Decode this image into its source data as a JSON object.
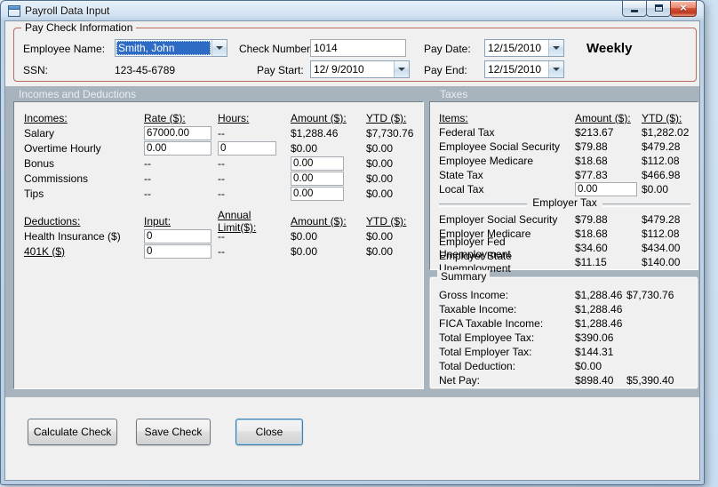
{
  "window": {
    "title": "Payroll Data Input",
    "icons": {
      "close": "×"
    }
  },
  "paycheck": {
    "legend": "Pay Check Information",
    "fields": {
      "employee_name": {
        "label": "Employee Name:",
        "value": "Smith, John"
      },
      "ssn": {
        "label": "SSN:",
        "value": "123-45-6789"
      },
      "check_number": {
        "label": "Check Number:",
        "value": "1014"
      },
      "pay_start": {
        "label": "Pay Start:",
        "value": "12/ 9/2010"
      },
      "pay_date": {
        "label": "Pay Date:",
        "value": "12/15/2010"
      },
      "pay_end": {
        "label": "Pay End:",
        "value": "12/15/2010"
      }
    },
    "frequency": "Weekly"
  },
  "incomes_section": {
    "label": "Incomes and Deductions",
    "incomes": {
      "headers": {
        "name": "Incomes:",
        "rate": "Rate ($):",
        "hours": "Hours:",
        "amount": "Amount ($):",
        "ytd": "YTD ($):"
      },
      "salary": {
        "label": "Salary",
        "rate": "67000.00",
        "hours": "--",
        "amount": "$1,288.46",
        "ytd": "$7,730.76"
      },
      "overtime": {
        "label": "Overtime Hourly",
        "rate": "0.00",
        "hours": "0",
        "amount": "$0.00",
        "ytd": "$0.00"
      },
      "bonus": {
        "label": "Bonus",
        "rate": "--",
        "hours": "--",
        "amount": "0.00",
        "ytd": "$0.00"
      },
      "commissions": {
        "label": "Commissions",
        "rate": "--",
        "hours": "--",
        "amount": "0.00",
        "ytd": "$0.00"
      },
      "tips": {
        "label": "Tips",
        "rate": "--",
        "hours": "--",
        "amount": "0.00",
        "ytd": "$0.00"
      }
    },
    "deductions": {
      "headers": {
        "name": "Deductions:",
        "input": "Input:",
        "limit": "Annual Limit($):",
        "amount": "Amount ($):",
        "ytd": "YTD ($):"
      },
      "health_insurance": {
        "label": "Health Insurance ($)",
        "input": "0",
        "limit": "--",
        "amount": "$0.00",
        "ytd": "$0.00"
      },
      "k401": {
        "label": "401K ($)",
        "input": "0",
        "limit": "--",
        "amount": "$0.00",
        "ytd": "$0.00"
      }
    }
  },
  "taxes": {
    "label": "Taxes",
    "headers": {
      "items": "Items:",
      "amount": "Amount ($):",
      "ytd": "YTD ($):"
    },
    "rows": [
      {
        "label": "Federal Tax",
        "amount": "$213.67",
        "ytd": "$1,282.02"
      },
      {
        "label": "Employee Social Security",
        "amount": "$79.88",
        "ytd": "$479.28"
      },
      {
        "label": "Employee Medicare",
        "amount": "$18.68",
        "ytd": "$112.08"
      },
      {
        "label": "State Tax",
        "amount": "$77.83",
        "ytd": "$466.98"
      }
    ],
    "local_tax": {
      "label": "Local Tax",
      "input": "0.00",
      "ytd": "$0.00"
    },
    "employer_header": "Employer Tax",
    "employer_rows": [
      {
        "label": "Employer Social Security",
        "amount": "$79.88",
        "ytd": "$479.28"
      },
      {
        "label": "Employer Medicare",
        "amount": "$18.68",
        "ytd": "$112.08"
      },
      {
        "label": "Employer Fed Unemployment",
        "amount": "$34.60",
        "ytd": "$434.00"
      },
      {
        "label": "Employer State Unemployment",
        "amount": "$11.15",
        "ytd": "$140.00"
      }
    ]
  },
  "summary": {
    "legend": "Summary",
    "rows": [
      {
        "label": "Gross Income:",
        "amount": "$1,288.46",
        "ytd": "$7,730.76"
      },
      {
        "label": "Taxable Income:",
        "amount": "$1,288.46",
        "ytd": ""
      },
      {
        "label": "FICA Taxable Income:",
        "amount": "$1,288.46",
        "ytd": ""
      },
      {
        "label": "Total Employee Tax:",
        "amount": "$390.06",
        "ytd": ""
      },
      {
        "label": "Total Employer Tax:",
        "amount": "$144.31",
        "ytd": ""
      },
      {
        "label": "Total Deduction:",
        "amount": "$0.00",
        "ytd": ""
      },
      {
        "label": "Net Pay:",
        "amount": "$898.40",
        "ytd": "$5,390.40"
      }
    ]
  },
  "buttons": {
    "calculate": "Calculate Check",
    "save": "Save Check",
    "close": "Close"
  }
}
